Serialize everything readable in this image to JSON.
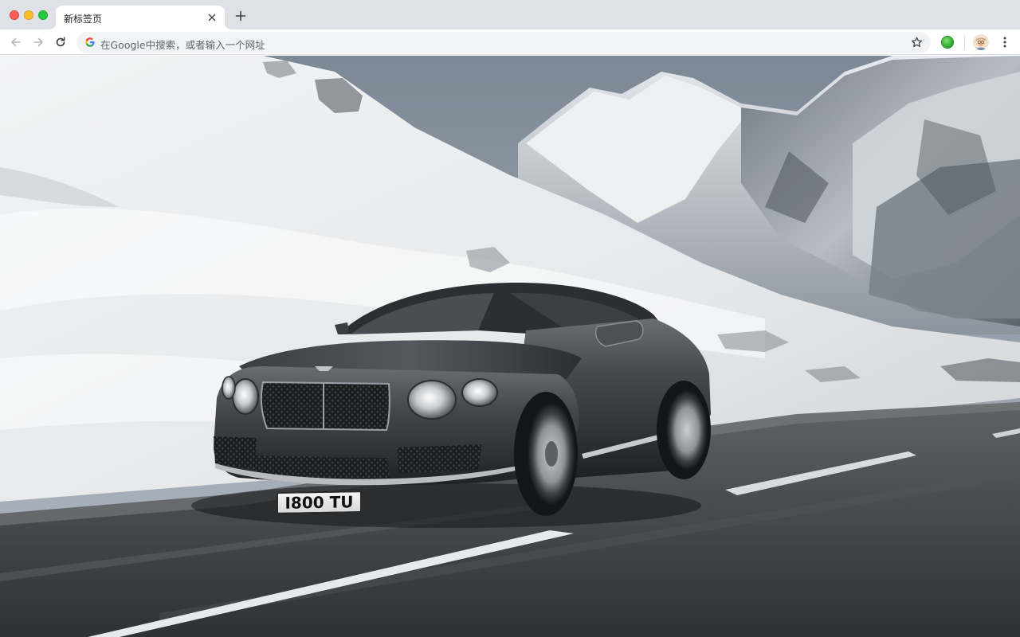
{
  "window": {
    "tab_title": "新标签页"
  },
  "toolbar": {
    "omnibox_placeholder": "在Google中搜索，或者输入一个网址"
  },
  "icons": {
    "back": "arrow-left-icon",
    "forward": "arrow-right-icon",
    "reload": "reload-icon",
    "google": "google-g-icon",
    "star": "bookmark-star-icon",
    "extension": "extension-icon",
    "avatar": "profile-avatar-icon",
    "menu": "more-vert-icon",
    "close": "close-icon",
    "new_tab": "plus-icon"
  },
  "colors": {
    "tabstrip": "#dee1e6",
    "omnibox": "#f1f3f4",
    "traffic_red": "#fe5f57",
    "traffic_yellow": "#febc2e",
    "traffic_green": "#28c840"
  },
  "wallpaper": {
    "license_plate": "I800 TU"
  }
}
